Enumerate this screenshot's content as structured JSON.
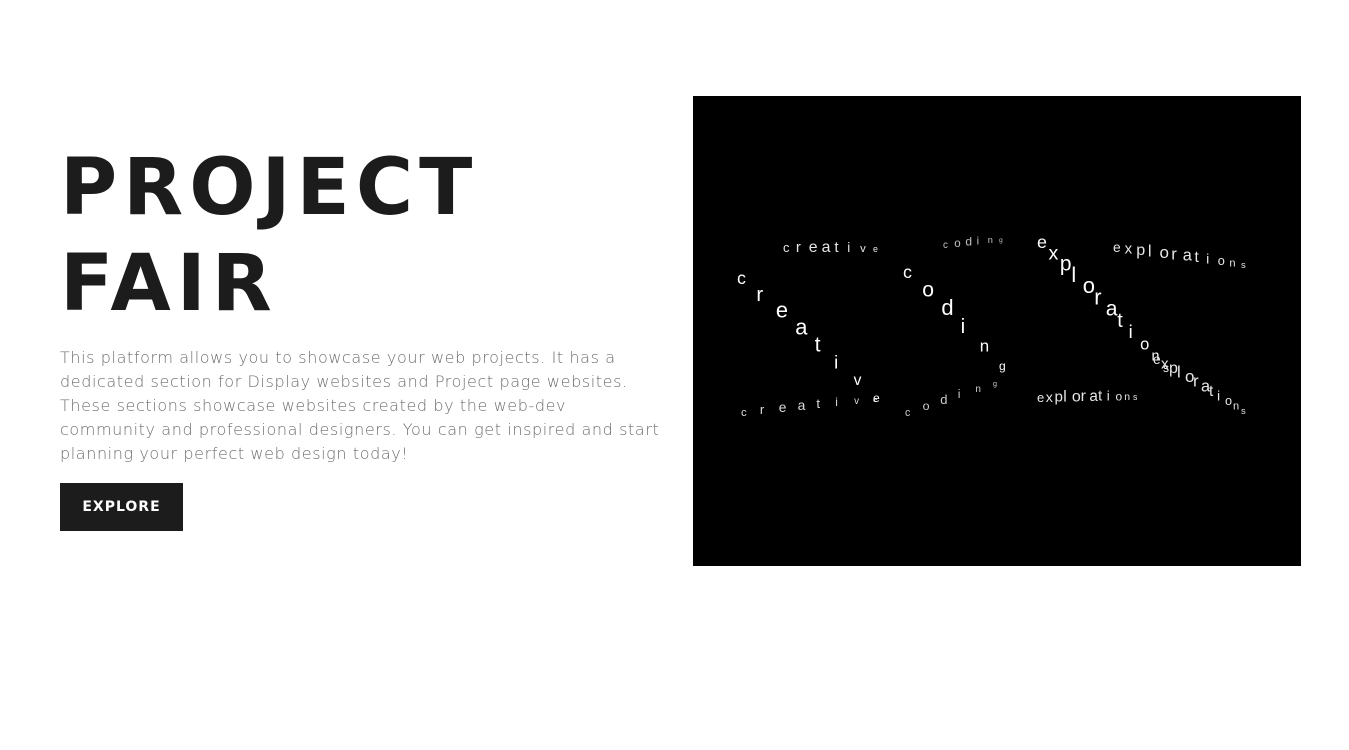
{
  "hero": {
    "title_line1": "PROJECT",
    "title_line2": "FAIR",
    "description": "This platform allows you to showcase your web projects. It has a dedicated section for Display websites and Project page websites. These sections showcase websites created by the web-dev community and professional designers. You can get inspired and start planning your perfect web design today!",
    "explore_label": "EXPLORE"
  },
  "animation": {
    "words": [
      "creative",
      "coding",
      "explorations"
    ]
  },
  "colors": {
    "text_dark": "#1c1c1c",
    "text_muted": "#6e6e6e",
    "media_bg": "#000000",
    "button_bg": "#1c1c1c",
    "button_text": "#ffffff"
  }
}
